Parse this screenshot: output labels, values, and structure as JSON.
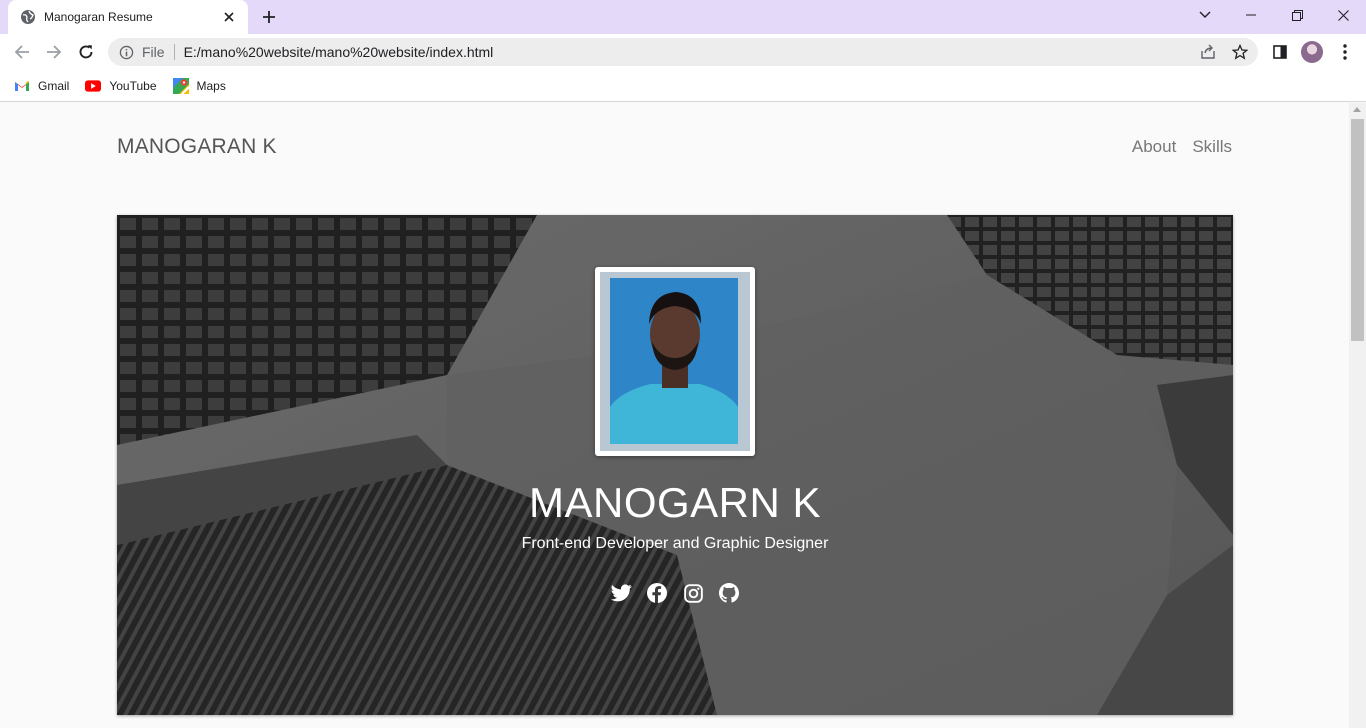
{
  "browser": {
    "tab_title": "Manogaran Resume",
    "scheme_label": "File",
    "url": "E:/mano%20website/mano%20website/index.html",
    "bookmarks": [
      {
        "label": "Gmail",
        "icon": "gmail-icon"
      },
      {
        "label": "YouTube",
        "icon": "youtube-icon"
      },
      {
        "label": "Maps",
        "icon": "maps-icon"
      }
    ]
  },
  "page": {
    "brand": "MANOGARAN K",
    "nav": [
      {
        "label": "About"
      },
      {
        "label": "Skills"
      }
    ],
    "hero": {
      "name": "MANOGARN K",
      "subtitle": "Front-end Developer and Graphic Designer",
      "social_icons": [
        "twitter-icon",
        "facebook-icon",
        "instagram-icon",
        "github-icon"
      ]
    }
  },
  "colors": {
    "tab_strip": "#e4d9f8",
    "page_bg": "#fafafa",
    "hero_text": "#ffffff",
    "brand_text": "#555555"
  }
}
